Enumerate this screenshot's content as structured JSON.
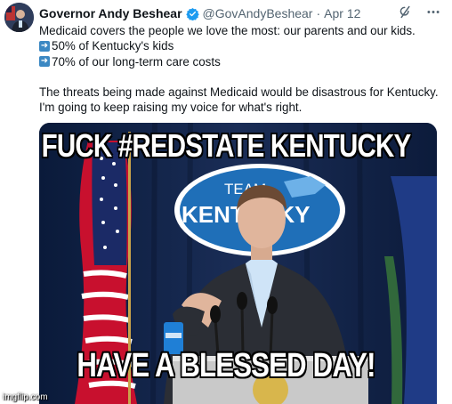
{
  "tweet": {
    "author_name": "Governor Andy Beshear",
    "handle": "@GovAndyBeshear",
    "separator": "·",
    "date": "Apr 12",
    "lines": [
      "Medicaid covers the people we love the most: our parents and our kids.",
      "50% of Kentucky's kids",
      "70% of our long-term care costs",
      "The threats being made against Medicaid would be disastrous for Kentucky.",
      "I'm going to keep raising my voice for what's right."
    ],
    "bullet_glyph": "➜"
  },
  "media": {
    "sign_text_top": "TEAM",
    "sign_text_main": "KENTUCKY"
  },
  "meme": {
    "top_text": "FUCK #REDSTATE KENTUCKY",
    "bottom_text": "HAVE A BLESSED DAY!",
    "watermark": "imgflip.com"
  },
  "colors": {
    "verified_badge": "#1d9bf0",
    "secondary_text": "#536471",
    "bullet_box": "#3b88c3",
    "sign_blue": "#1f6fb8"
  },
  "icons": [
    "grok-icon",
    "more-icon",
    "verified-badge-icon",
    "arrow-right-icon"
  ]
}
